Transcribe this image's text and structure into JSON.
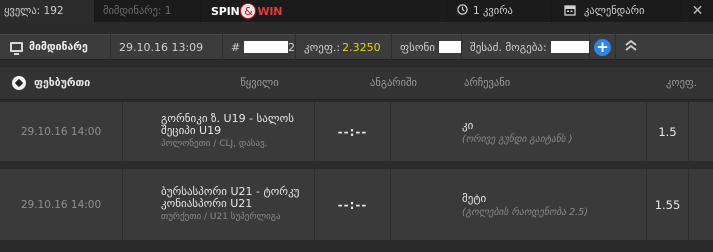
{
  "topbar": {
    "all_tab": "ყველა: 192",
    "live_tab": "მიმდინარე: 1",
    "spin_win": {
      "spin": "SPIN",
      "amp": "&",
      "win": "WIN"
    },
    "week_tab": "1 კვირა",
    "calendar_tab": "კალენდარი",
    "icons": {
      "week": "clock-icon",
      "calendar": "calendar-icon",
      "close": "close-icon"
    }
  },
  "slip": {
    "live_label": "მიმდინარე",
    "date": "29.10.16 13:09",
    "id_prefix": "#",
    "id_suffix": "2",
    "odds_label": "კოეფ.:",
    "odds_value": "2.3250",
    "stake_label": "ფსონი",
    "win_label": "შესაძ. მოგება:",
    "icons": {
      "live": "monitor-icon",
      "add": "plus-icon",
      "collapse": "chevrons-up-icon"
    },
    "colors": {
      "odds": "#e5d219",
      "add_button": "#2e86de"
    }
  },
  "table": {
    "sport": "ფეხბურთი",
    "sport_icon": "soccer-ball-icon",
    "headers": {
      "event": "წყვილი",
      "score": "ანგარიში",
      "pick": "არჩევანი",
      "odds": "კოეფ."
    },
    "rows": [
      {
        "date": "29.10.16 14:00",
        "event": "გორნიკი ზ. U19 - სალოს შეციპი U19",
        "league": "პოლონეთი / CLJ, დასავ.",
        "score": "--:--",
        "pick": "კი",
        "pick_detail": "(ორივე გუნდი გაიტანს )",
        "odds": "1.5"
      },
      {
        "date": "29.10.16 14:00",
        "event": "ბურსასპორი U21 - ტორკუ კონიასპორი U21",
        "league": "თურქეთი / U21 სუპერლიგა",
        "score": "--:--",
        "pick": "მეტი",
        "pick_detail": "(გოლების რაოდენობა 2.5)",
        "odds": "1.55"
      }
    ]
  }
}
